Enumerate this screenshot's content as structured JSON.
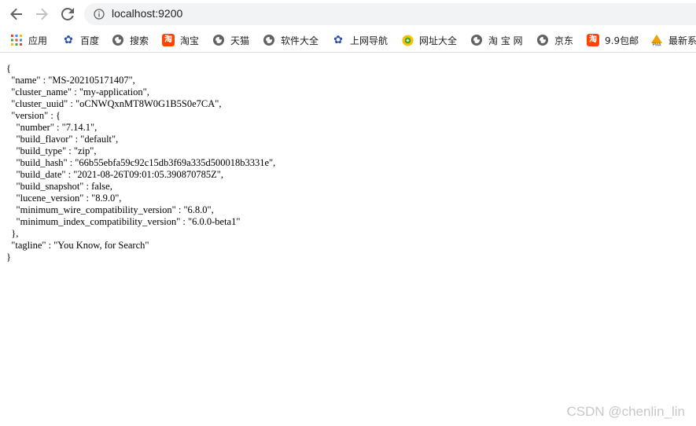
{
  "browser": {
    "url": "localhost:9200",
    "bookmarks": [
      {
        "label": "应用",
        "icon": "apps-grid-icon"
      },
      {
        "label": "百度",
        "icon": "baidu-paw-icon"
      },
      {
        "label": "搜索",
        "icon": "globe-icon"
      },
      {
        "label": "淘宝",
        "icon": "taobao-icon"
      },
      {
        "label": "天猫",
        "icon": "globe-icon"
      },
      {
        "label": "软件大全",
        "icon": "globe-icon"
      },
      {
        "label": "上网导航",
        "icon": "baidu-paw-icon"
      },
      {
        "label": "网址大全",
        "icon": "hao123-icon"
      },
      {
        "label": "淘 宝 网",
        "icon": "globe-icon"
      },
      {
        "label": "京东",
        "icon": "globe-icon"
      },
      {
        "label": "9.9包邮",
        "icon": "taobao-icon"
      },
      {
        "label": "最新系",
        "icon": "pma-icon"
      }
    ]
  },
  "response": {
    "lines": [
      "{",
      "  \"name\" : \"MS-202105171407\",",
      "  \"cluster_name\" : \"my-application\",",
      "  \"cluster_uuid\" : \"oCNWQxnMT8W0G1B5S0e7CA\",",
      "  \"version\" : {",
      "    \"number\" : \"7.14.1\",",
      "    \"build_flavor\" : \"default\",",
      "    \"build_type\" : \"zip\",",
      "    \"build_hash\" : \"66b55ebfa59c92c15db3f69a335d500018b3331e\",",
      "    \"build_date\" : \"2021-08-26T09:01:05.390870785Z\",",
      "    \"build_snapshot\" : false,",
      "    \"lucene_version\" : \"8.9.0\",",
      "    \"minimum_wire_compatibility_version\" : \"6.8.0\",",
      "    \"minimum_index_compatibility_version\" : \"6.0.0-beta1\"",
      "  },",
      "  \"tagline\" : \"You Know, for Search\"",
      "}"
    ]
  },
  "watermark": "CSDN @chenlin_lin",
  "colors": {
    "taobao": "#ff4400",
    "baidu": "#2b4ea8",
    "omnibox": "#f1f3f4"
  }
}
